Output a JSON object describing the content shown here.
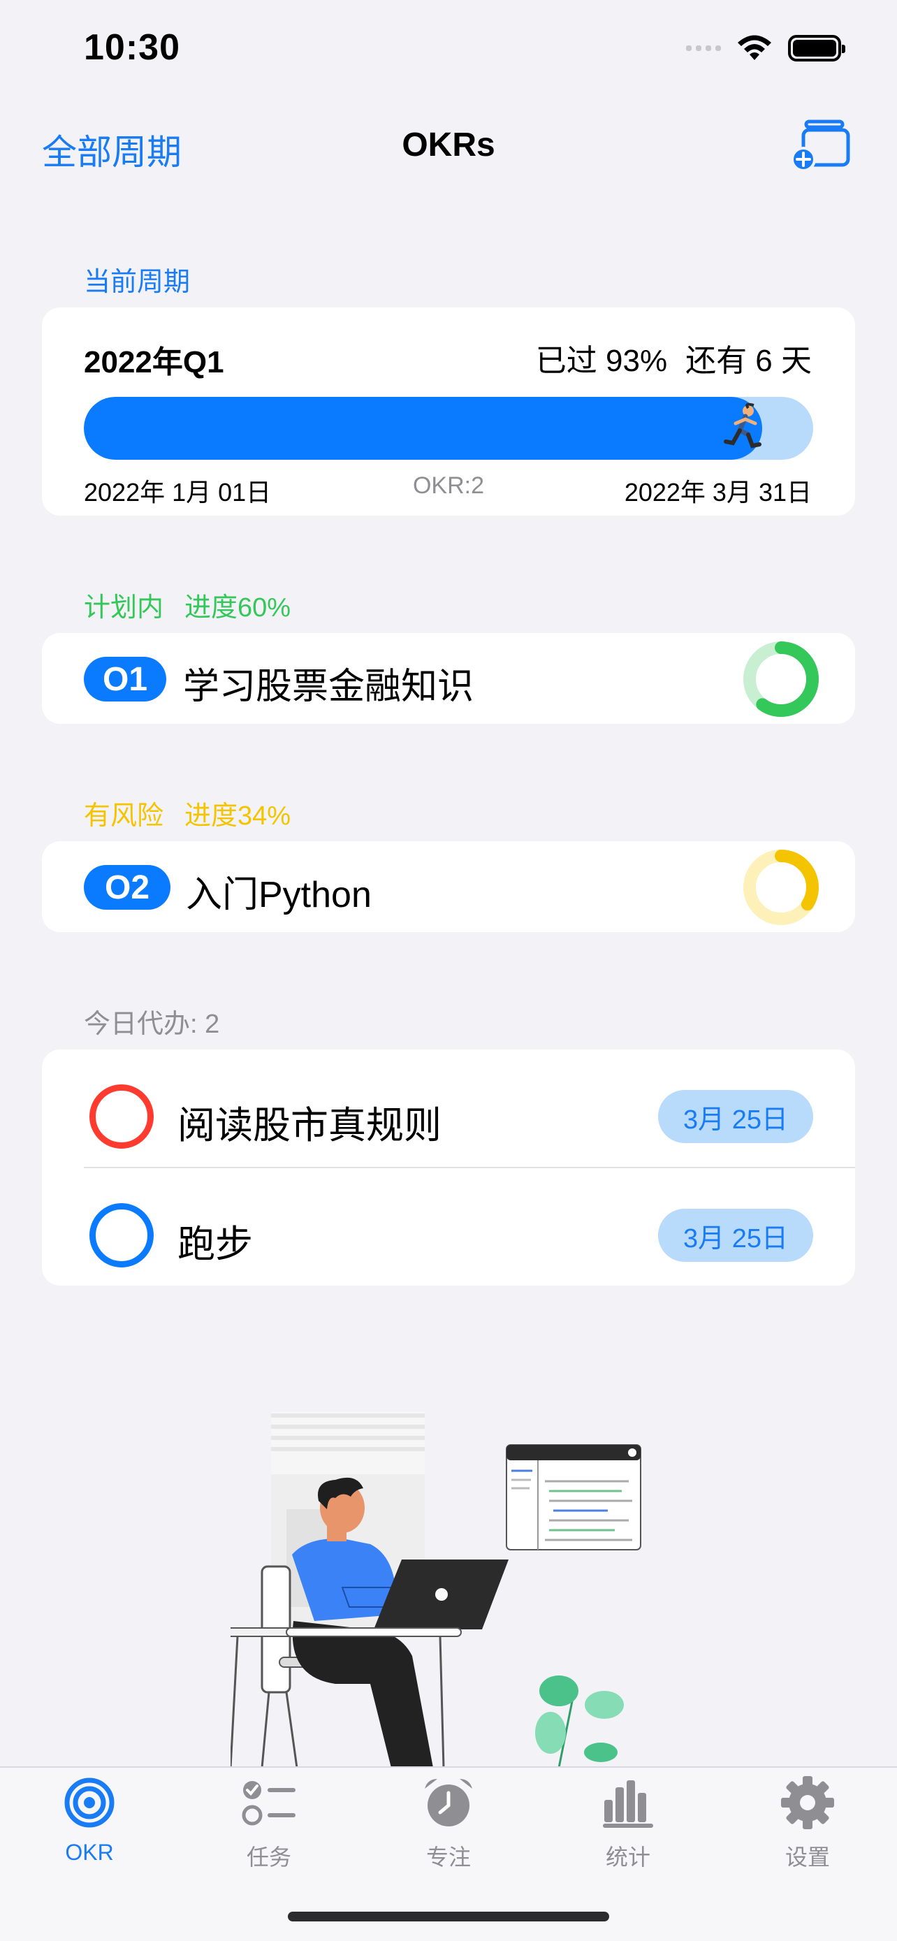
{
  "status": {
    "time": "10:30"
  },
  "nav": {
    "left_label": "全部周期",
    "title": "OKRs"
  },
  "current_period": {
    "section_label": "当前周期",
    "name": "2022年Q1",
    "elapsed": "已过 93%",
    "remaining": "还有 6 天",
    "progress": 0.93,
    "start_date": "2022年 1月 01日",
    "okr_count": "OKR:2",
    "end_date": "2022年 3月 31日"
  },
  "objectives": [
    {
      "status_label": "计划内",
      "progress_label": "进度60%",
      "badge": "O1",
      "title": "学习股票金融知识",
      "progress": 0.6,
      "ring_color": "#34c759",
      "ring_bg": "#c8efd2"
    },
    {
      "status_label": "有风险",
      "progress_label": "进度34%",
      "badge": "O2",
      "title": "入门Python",
      "progress": 0.34,
      "ring_color": "#f5c400",
      "ring_bg": "#fdf0b8"
    }
  ],
  "todos": {
    "section_label": "今日代办: 2",
    "items": [
      {
        "title": "阅读股市真规则",
        "date": "3月 25日",
        "circle_color": "#ff3b30"
      },
      {
        "title": "跑步",
        "date": "3月 25日",
        "circle_color": "#0a7aff"
      }
    ]
  },
  "tabs": [
    {
      "label": "OKR",
      "icon": "target-icon",
      "active": true
    },
    {
      "label": "任务",
      "icon": "checklist-icon",
      "active": false
    },
    {
      "label": "专注",
      "icon": "alarm-clock-icon",
      "active": false
    },
    {
      "label": "统计",
      "icon": "bar-chart-icon",
      "active": false
    },
    {
      "label": "设置",
      "icon": "gear-icon",
      "active": false
    }
  ]
}
